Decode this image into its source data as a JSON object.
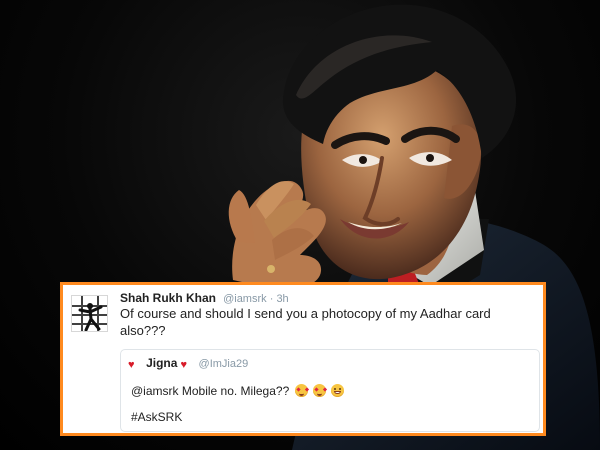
{
  "tweet": {
    "author_name": "Shah Rukh Khan",
    "handle": "@iamsrk",
    "separator": "·",
    "time": "3h",
    "text": "Of course and should I send you a photocopy of my Aadhar card also???",
    "quoted_tweet": {
      "author_name": "Jigna",
      "handle": "@ImJia29",
      "text": "@iamsrk Mobile no. Milega??",
      "hashtag": "#AskSRK",
      "emojis": [
        "heart-eyes-icon",
        "heart-eyes-icon",
        "laugh-icon"
      ]
    }
  },
  "colors": {
    "background": "#000000",
    "card_border": "#ff8a1f",
    "heart": "#d81b29",
    "muted_text": "#8899a6",
    "body_text": "#222222"
  }
}
